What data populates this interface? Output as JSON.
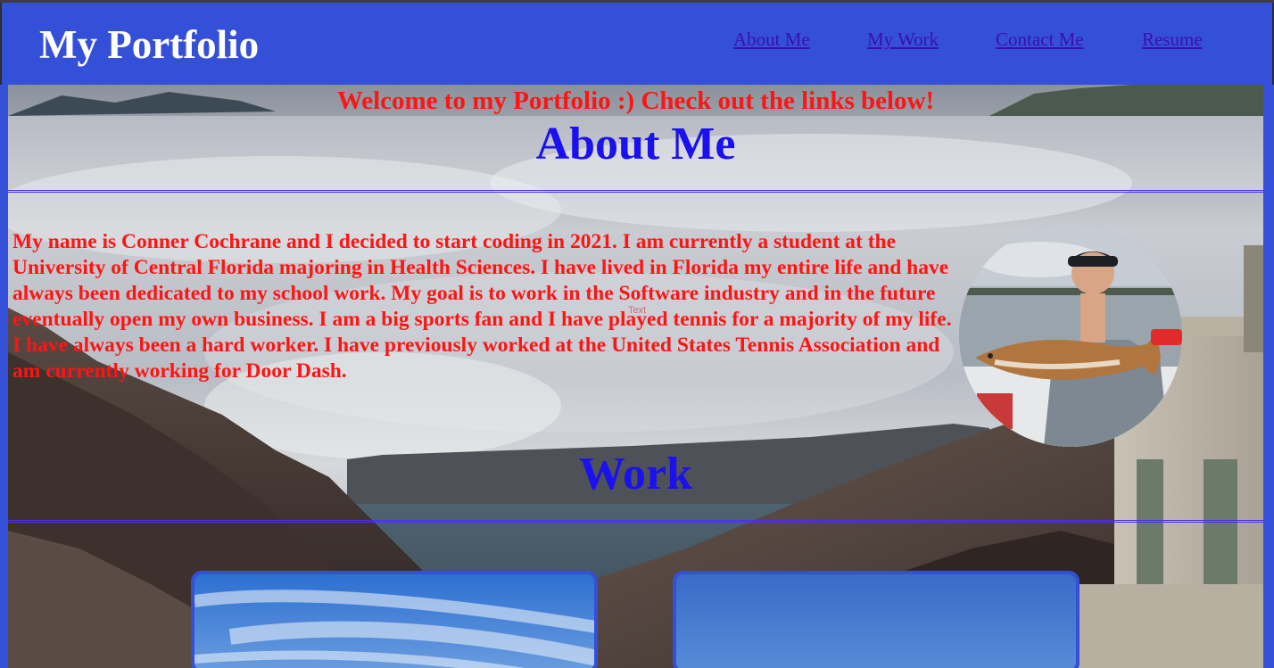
{
  "header": {
    "brand": "My Portfolio",
    "nav": [
      {
        "label": "About Me"
      },
      {
        "label": "My Work"
      },
      {
        "label": "Contact Me"
      },
      {
        "label": "Resume"
      }
    ]
  },
  "hero": {
    "welcome": "Welcome to my Portfolio :) Check out the links below!"
  },
  "about": {
    "title": "About Me",
    "bio": "My name is Conner Cochrane and I decided to start coding in 2021. I am currently a student at the University of Central Florida majoring in Health Sciences. I have lived in Florida my entire life and have always been dedicated to my school work. My goal is to work in the Software industry and in the future eventually open my own business. I am a big sports fan and I have played tennis for a majority of my life. I have always been a hard worker. I have previously worked at the United States Tennis Association and am currently working for Door Dash.",
    "stray_label": "Text"
  },
  "work": {
    "title": "Work"
  },
  "colors": {
    "header_bg": "#3550d8",
    "heading_blue": "#1a10f0",
    "text_red": "#ff1414",
    "nav_link": "#3a0fb0"
  }
}
